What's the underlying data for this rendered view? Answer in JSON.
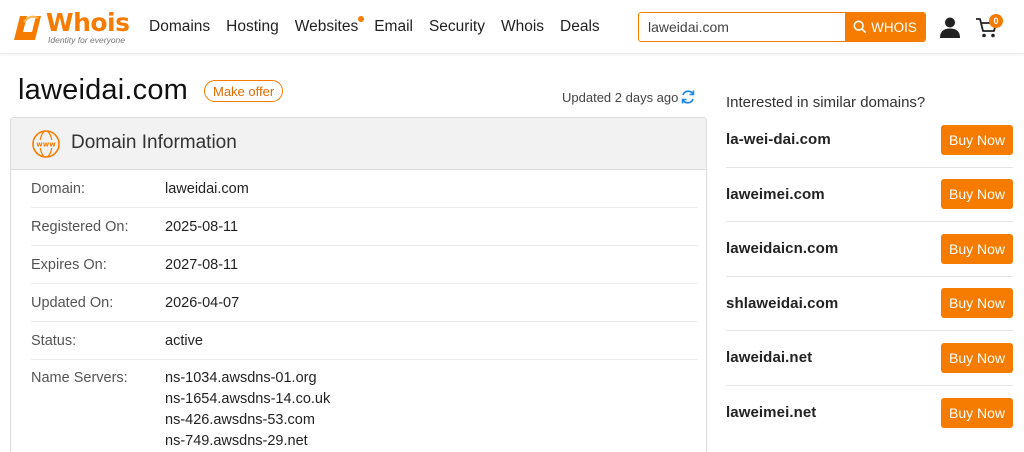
{
  "header": {
    "logo_text": "Whois",
    "logo_tagline": "Identity for everyone",
    "nav": [
      {
        "label": "Domains"
      },
      {
        "label": "Hosting"
      },
      {
        "label": "Websites"
      },
      {
        "label": "Email"
      },
      {
        "label": "Security"
      },
      {
        "label": "Whois"
      },
      {
        "label": "Deals"
      }
    ],
    "search_value": "laweidai.com",
    "search_button": "WHOIS",
    "cart_count": "0"
  },
  "title": {
    "domain": "laweidai.com",
    "make_offer": "Make offer",
    "updated": "Updated 2 days ago"
  },
  "info": {
    "heading": "Domain Information",
    "rows": [
      {
        "label": "Domain:",
        "value": "laweidai.com"
      },
      {
        "label": "Registered On:",
        "value": "2025-08-11"
      },
      {
        "label": "Expires On:",
        "value": "2027-08-11"
      },
      {
        "label": "Updated On:",
        "value": "2026-04-07"
      },
      {
        "label": "Status:",
        "value": "active"
      }
    ],
    "ns_label": "Name Servers:",
    "name_servers": [
      "ns-1034.awsdns-01.org",
      "ns-1654.awsdns-14.co.uk",
      "ns-426.awsdns-53.com",
      "ns-749.awsdns-29.net"
    ]
  },
  "sidebar": {
    "title": "Interested in similar domains?",
    "buy_label": "Buy Now",
    "domains": [
      {
        "name": "la-wei-dai.com"
      },
      {
        "name": "laweimei.com"
      },
      {
        "name": "laweidaicn.com"
      },
      {
        "name": "shlaweidai.com"
      },
      {
        "name": "laweidai.net"
      },
      {
        "name": "laweimei.net"
      }
    ]
  },
  "colors": {
    "accent": "#f57c00",
    "refresh": "#1e88e5"
  }
}
